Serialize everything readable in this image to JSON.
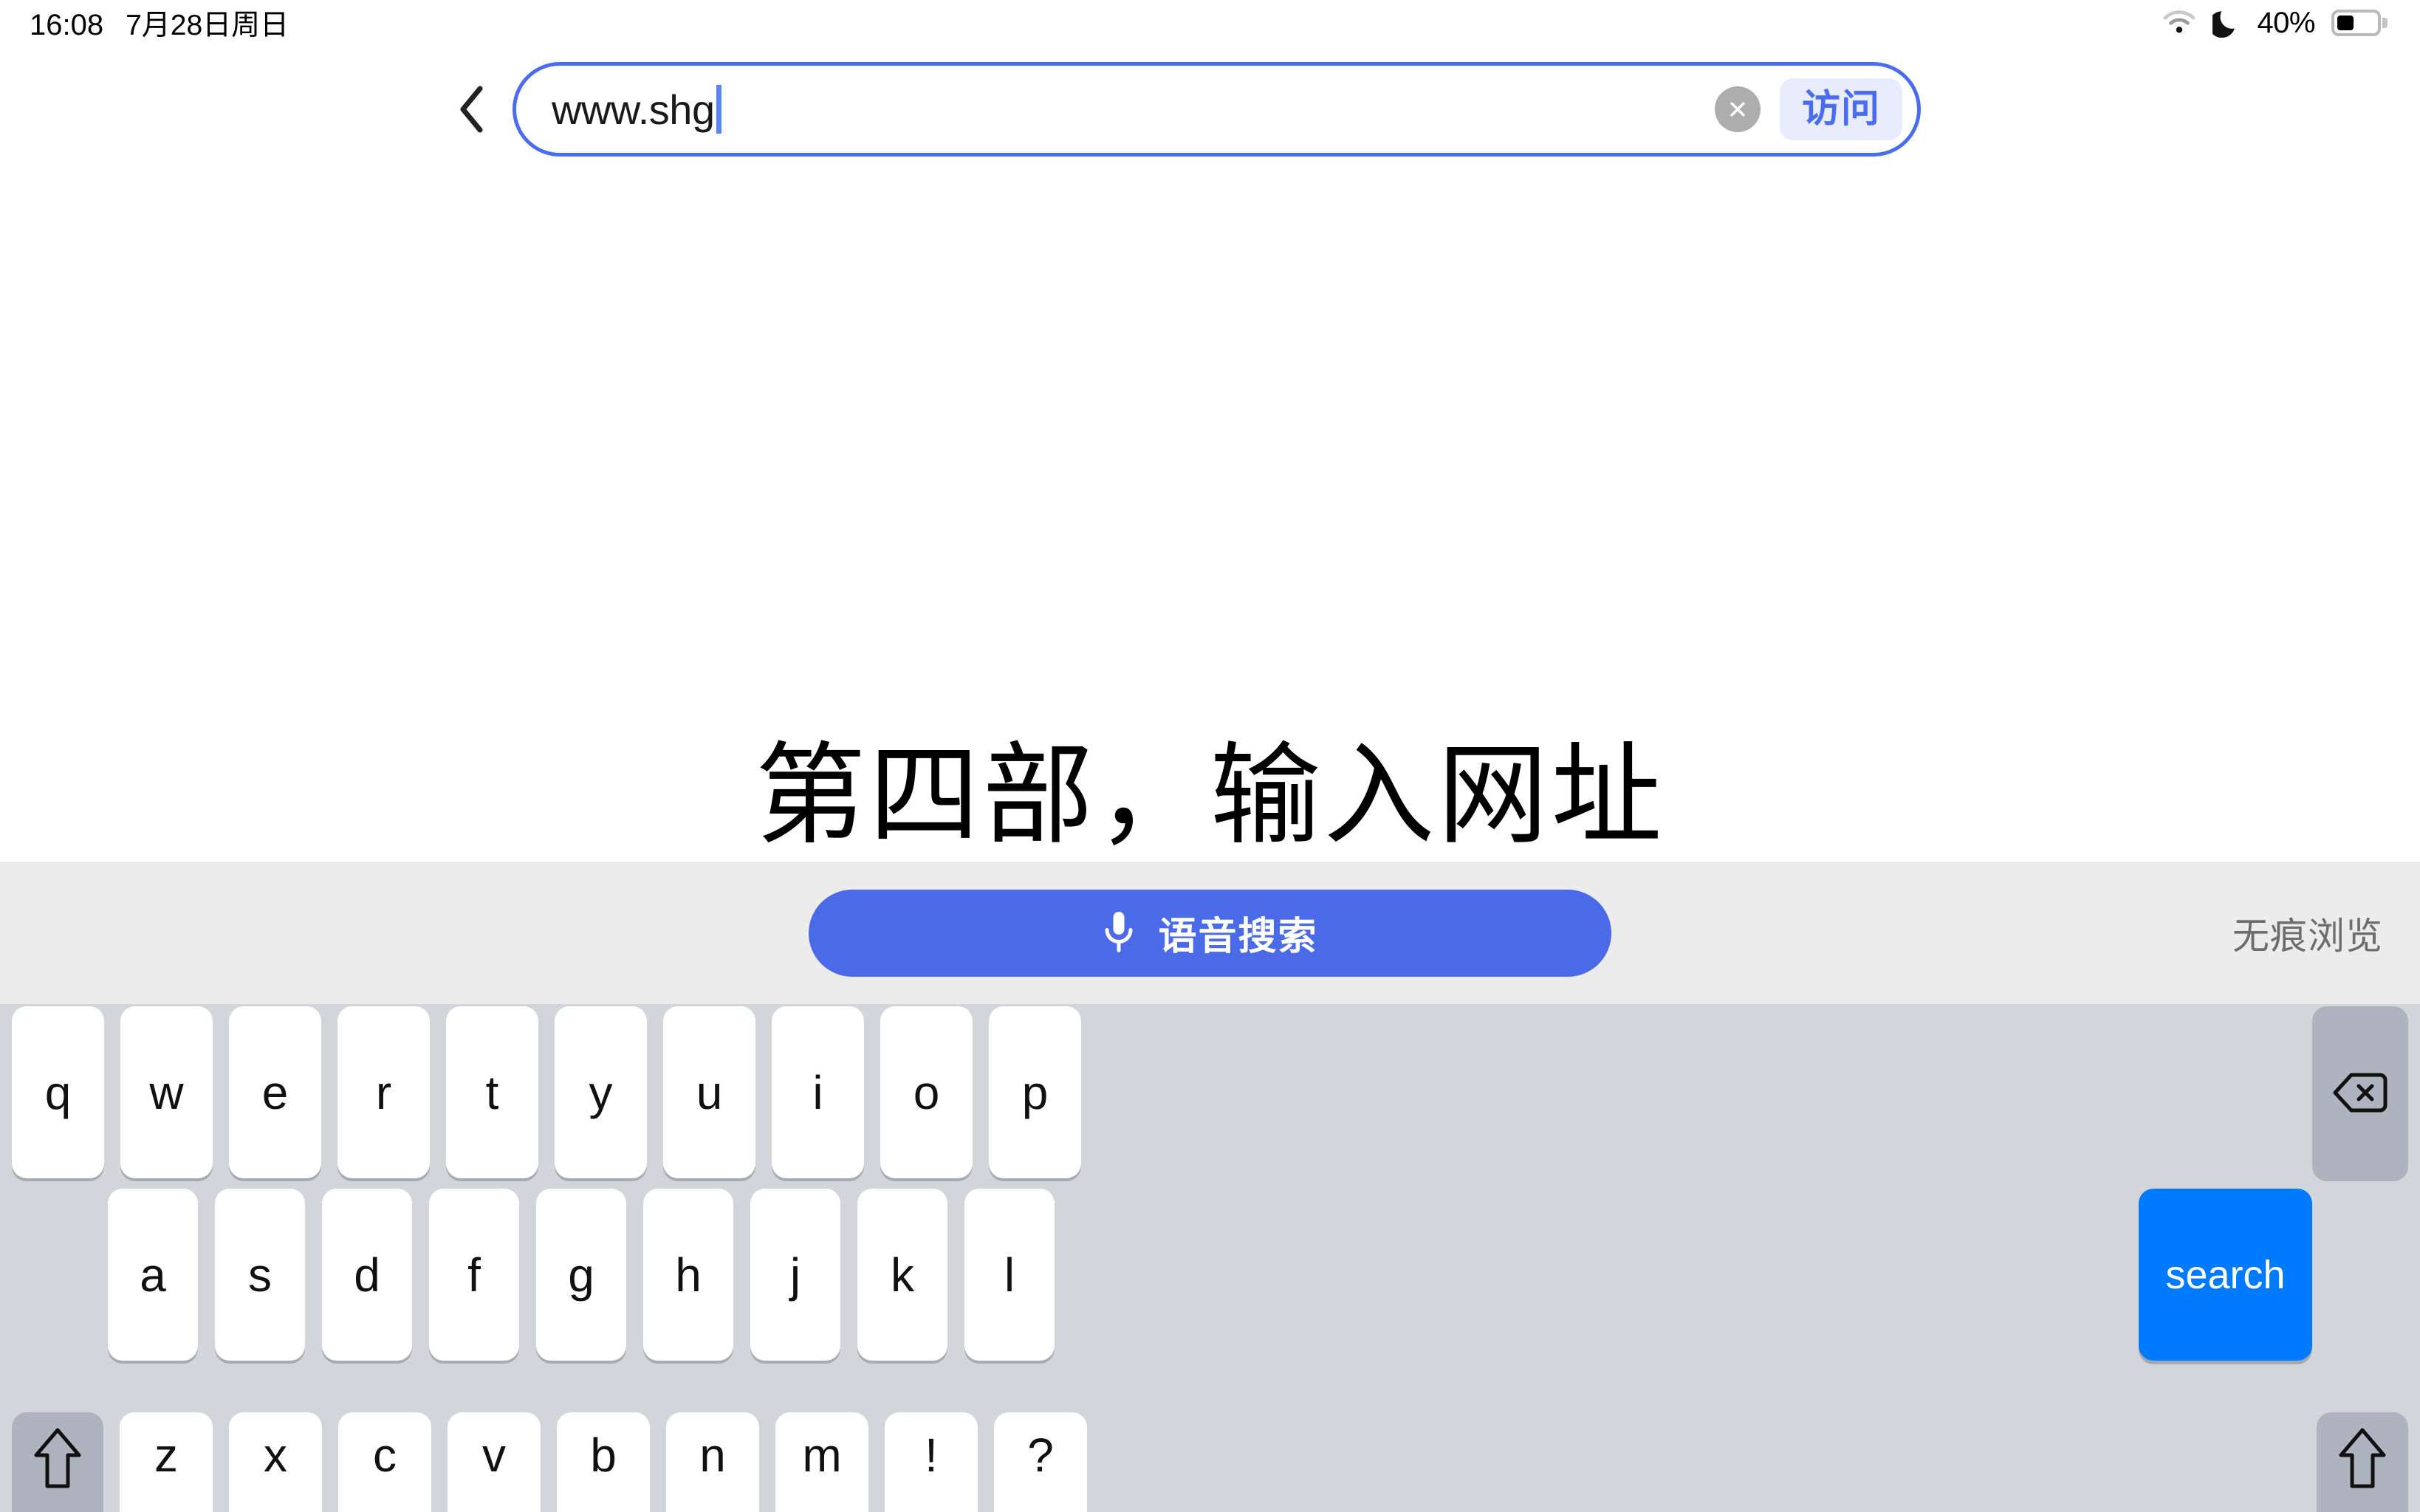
{
  "statusbar": {
    "time": "16:08",
    "date": "7月28日周日",
    "battery_percent": "40%",
    "battery_level": 40,
    "icons": {
      "wifi": "wifi-icon",
      "dnd": "moon-icon",
      "battery": "battery-icon"
    }
  },
  "urlbar": {
    "back_icon": "chevron-left-icon",
    "value": "www.shg",
    "clear_icon": "clear-circle-icon",
    "visit_label": "访问",
    "border_color": "#4a6cf0",
    "visit_bg": "#e8ecfd",
    "visit_fg": "#4a6cf0"
  },
  "page": {
    "headline": "第四部，输入网址"
  },
  "toolbar": {
    "voice_label": "语音搜索",
    "mic_icon": "microphone-icon",
    "voice_bg": "#4a6ae8",
    "incognito_label": "无痕浏览",
    "bar_bg": "#ececec"
  },
  "keyboard": {
    "bg": "#d2d5da",
    "key_bg": "#ffffff",
    "modifier_bg": "#aeb4bf",
    "enter_bg": "#007aff",
    "row1": [
      "q",
      "w",
      "e",
      "r",
      "t",
      "y",
      "u",
      "i",
      "o",
      "p"
    ],
    "row1_action": {
      "icon": "backspace-icon",
      "name": "backspace-key"
    },
    "row2": [
      "a",
      "s",
      "d",
      "f",
      "g",
      "h",
      "j",
      "k",
      "l"
    ],
    "row2_action": {
      "label": "search",
      "name": "search-key"
    },
    "row3": [
      "z",
      "x",
      "c",
      "v",
      "b",
      "n",
      "m",
      "!",
      "?"
    ],
    "row3_left_action": {
      "icon": "shift-icon",
      "name": "shift-key-left"
    },
    "row3_right_action": {
      "icon": "shift-icon",
      "name": "shift-key-right"
    }
  }
}
